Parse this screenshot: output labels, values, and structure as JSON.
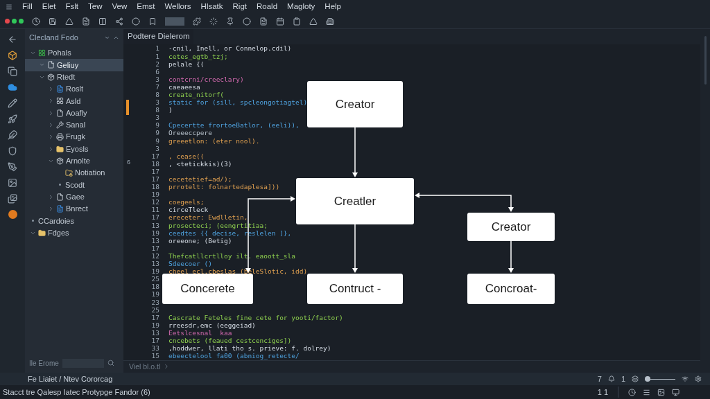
{
  "menu_bar": {
    "items": [
      "Fill",
      "Elet",
      "Fslt",
      "Tew",
      "Vew",
      "Emst",
      "Wellors",
      "Hlsatk",
      "Rigt",
      "Roald",
      "Magloty",
      "Help"
    ]
  },
  "sidebar": {
    "title": "Clecland Fodo",
    "tree": [
      {
        "label": "Pohals",
        "kind": "project",
        "expanded": true,
        "selected": false,
        "children": [
          {
            "label": "Geliuy",
            "kind": "file",
            "expanded": true,
            "selected": true
          },
          {
            "label": "Rtedt",
            "kind": "module",
            "expanded": true,
            "selected": false,
            "children": [
              {
                "label": "Roslt",
                "kind": "document",
                "expanded": false,
                "selected": false
              },
              {
                "label": "Asld",
                "kind": "grid",
                "expanded": false,
                "selected": false
              },
              {
                "label": "Aoafly",
                "kind": "file",
                "expanded": false,
                "selected": false
              },
              {
                "label": "Sanal",
                "kind": "tool",
                "expanded": false,
                "selected": false
              },
              {
                "label": "Frugk",
                "kind": "printer",
                "expanded": false,
                "selected": false
              },
              {
                "label": "Eyosls",
                "kind": "folder",
                "expanded": false,
                "selected": false
              },
              {
                "label": "Arnolte",
                "kind": "module",
                "expanded": true,
                "selected": false,
                "children": [
                  {
                    "label": "Notiation",
                    "kind": "locked-folder",
                    "selected": false
                  },
                  {
                    "label": "Scodt",
                    "kind": "plain",
                    "selected": false
                  }
                ]
              },
              {
                "label": "Gaee",
                "kind": "file",
                "expanded": false,
                "selected": false
              },
              {
                "label": "Bnrect",
                "kind": "document",
                "expanded": false,
                "selected": false
              }
            ]
          }
        ]
      },
      {
        "label": "CCardoies",
        "kind": "plain",
        "selected": false
      },
      {
        "label": "Fdges",
        "kind": "folder",
        "expanded": true,
        "selected": false
      }
    ],
    "search": {
      "label": "Ile Erome"
    },
    "status": "Fe Liaiet / Ntev Cororcag"
  },
  "editor": {
    "tab": {
      "label": "Podtere Dielerom",
      "selected": true
    },
    "gutter_note": "6",
    "lines": [
      {
        "number": "1",
        "text": "-cnil, Inell, or Connelop.cdil)",
        "kind": "plain"
      },
      {
        "number": "1",
        "text": "cetes_egtb_tzj;",
        "kind": "string"
      },
      {
        "number": "2",
        "text": "pelale {(",
        "kind": "plain"
      },
      {
        "number": "6"
      },
      {
        "number": "3",
        "text": "contcrni/creeclary)",
        "kind": "keyword"
      },
      {
        "number": "7",
        "text": "caeaeesa",
        "kind": "plain"
      },
      {
        "number": "8",
        "text": "create_nitorf(",
        "kind": "string"
      },
      {
        "number": "3",
        "text": "static for (sill, spcleongotiagtel)",
        "kind": "type"
      },
      {
        "number": "8",
        "text": ")",
        "kind": "plain"
      },
      {
        "number": "3"
      },
      {
        "number": "9",
        "text": "Cpecertte frortoeBatlor, (eeli)),",
        "kind": "type"
      },
      {
        "number": "9",
        "text": "Oreeeccpere",
        "kind": "comment"
      },
      {
        "number": "9",
        "text": "greeetlon: (eter nool).",
        "kind": "number"
      },
      {
        "number": "3"
      },
      {
        "number": "17",
        "text": ", cease((",
        "kind": "number"
      },
      {
        "number": "18",
        "text": ", <tetickkis)(3)",
        "kind": "plain"
      },
      {
        "number": "17"
      },
      {
        "number": "17",
        "text": "cecetetief=ad/);",
        "kind": "number"
      },
      {
        "number": "18",
        "text": "prrotelt: folnartedaplesa]))",
        "kind": "number"
      },
      {
        "number": "19"
      },
      {
        "number": "12",
        "text": "coegeels;",
        "kind": "number"
      },
      {
        "number": "11",
        "text": "circeTleck",
        "kind": "plain"
      },
      {
        "number": "17",
        "text": "ereceter: Ewdlletin,",
        "kind": "number"
      },
      {
        "number": "13",
        "text": "prosecteci; (eengrtitiaa;",
        "kind": "string"
      },
      {
        "number": "19",
        "text": "ceedtes {{ decise, reslelen ]},",
        "kind": "type"
      },
      {
        "number": "13",
        "text": "oreeone; (Betig)",
        "kind": "plain"
      },
      {
        "number": "17"
      },
      {
        "number": "12",
        "text": "Thefcatllcrtlloy ilt. eaoott_sla",
        "kind": "string"
      },
      {
        "number": "13",
        "text": "Sdeecoer ()",
        "kind": "type"
      },
      {
        "number": "19",
        "text": "cheel ecl.cbeslas (beleSlotic, idd)",
        "kind": "number"
      },
      {
        "number": "25"
      },
      {
        "number": "18"
      },
      {
        "number": "19"
      },
      {
        "number": "23"
      },
      {
        "number": "25"
      },
      {
        "number": "17",
        "text": "Cascrate Feteles fine cete for yooti/factor)",
        "kind": "string"
      },
      {
        "number": "19",
        "text": "rreesdr,emc (eeggeiad)",
        "kind": "plain"
      },
      {
        "number": "13",
        "text": "Eetslcesnal  kaa",
        "kind": "keyword"
      },
      {
        "number": "17",
        "text": "cncebets (feaued cestcenciges])",
        "kind": "string"
      },
      {
        "number": "33",
        "text": ",hoddwer, llati tho s. prieve: f. dolrey)",
        "kind": "plain"
      },
      {
        "number": "15",
        "text": "ebeectelool fa00 (abniog_retecte/",
        "kind": "type"
      }
    ],
    "diagram": {
      "nodes": [
        {
          "label": "Creator"
        },
        {
          "label": "Creatler"
        },
        {
          "label": "Creator"
        },
        {
          "label": "Concerete"
        },
        {
          "label": "Contruct -"
        },
        {
          "label": "Concroat-"
        }
      ]
    },
    "prompt": "Viel bl.o.tl"
  },
  "editor_status": {
    "column": "7",
    "line": "1",
    "zoom": {
      "level": 0.1
    }
  },
  "status_bar": {
    "message": "Stacct tre Qalesp Iatec Protypge Fandor (6)",
    "position": "1 1"
  }
}
